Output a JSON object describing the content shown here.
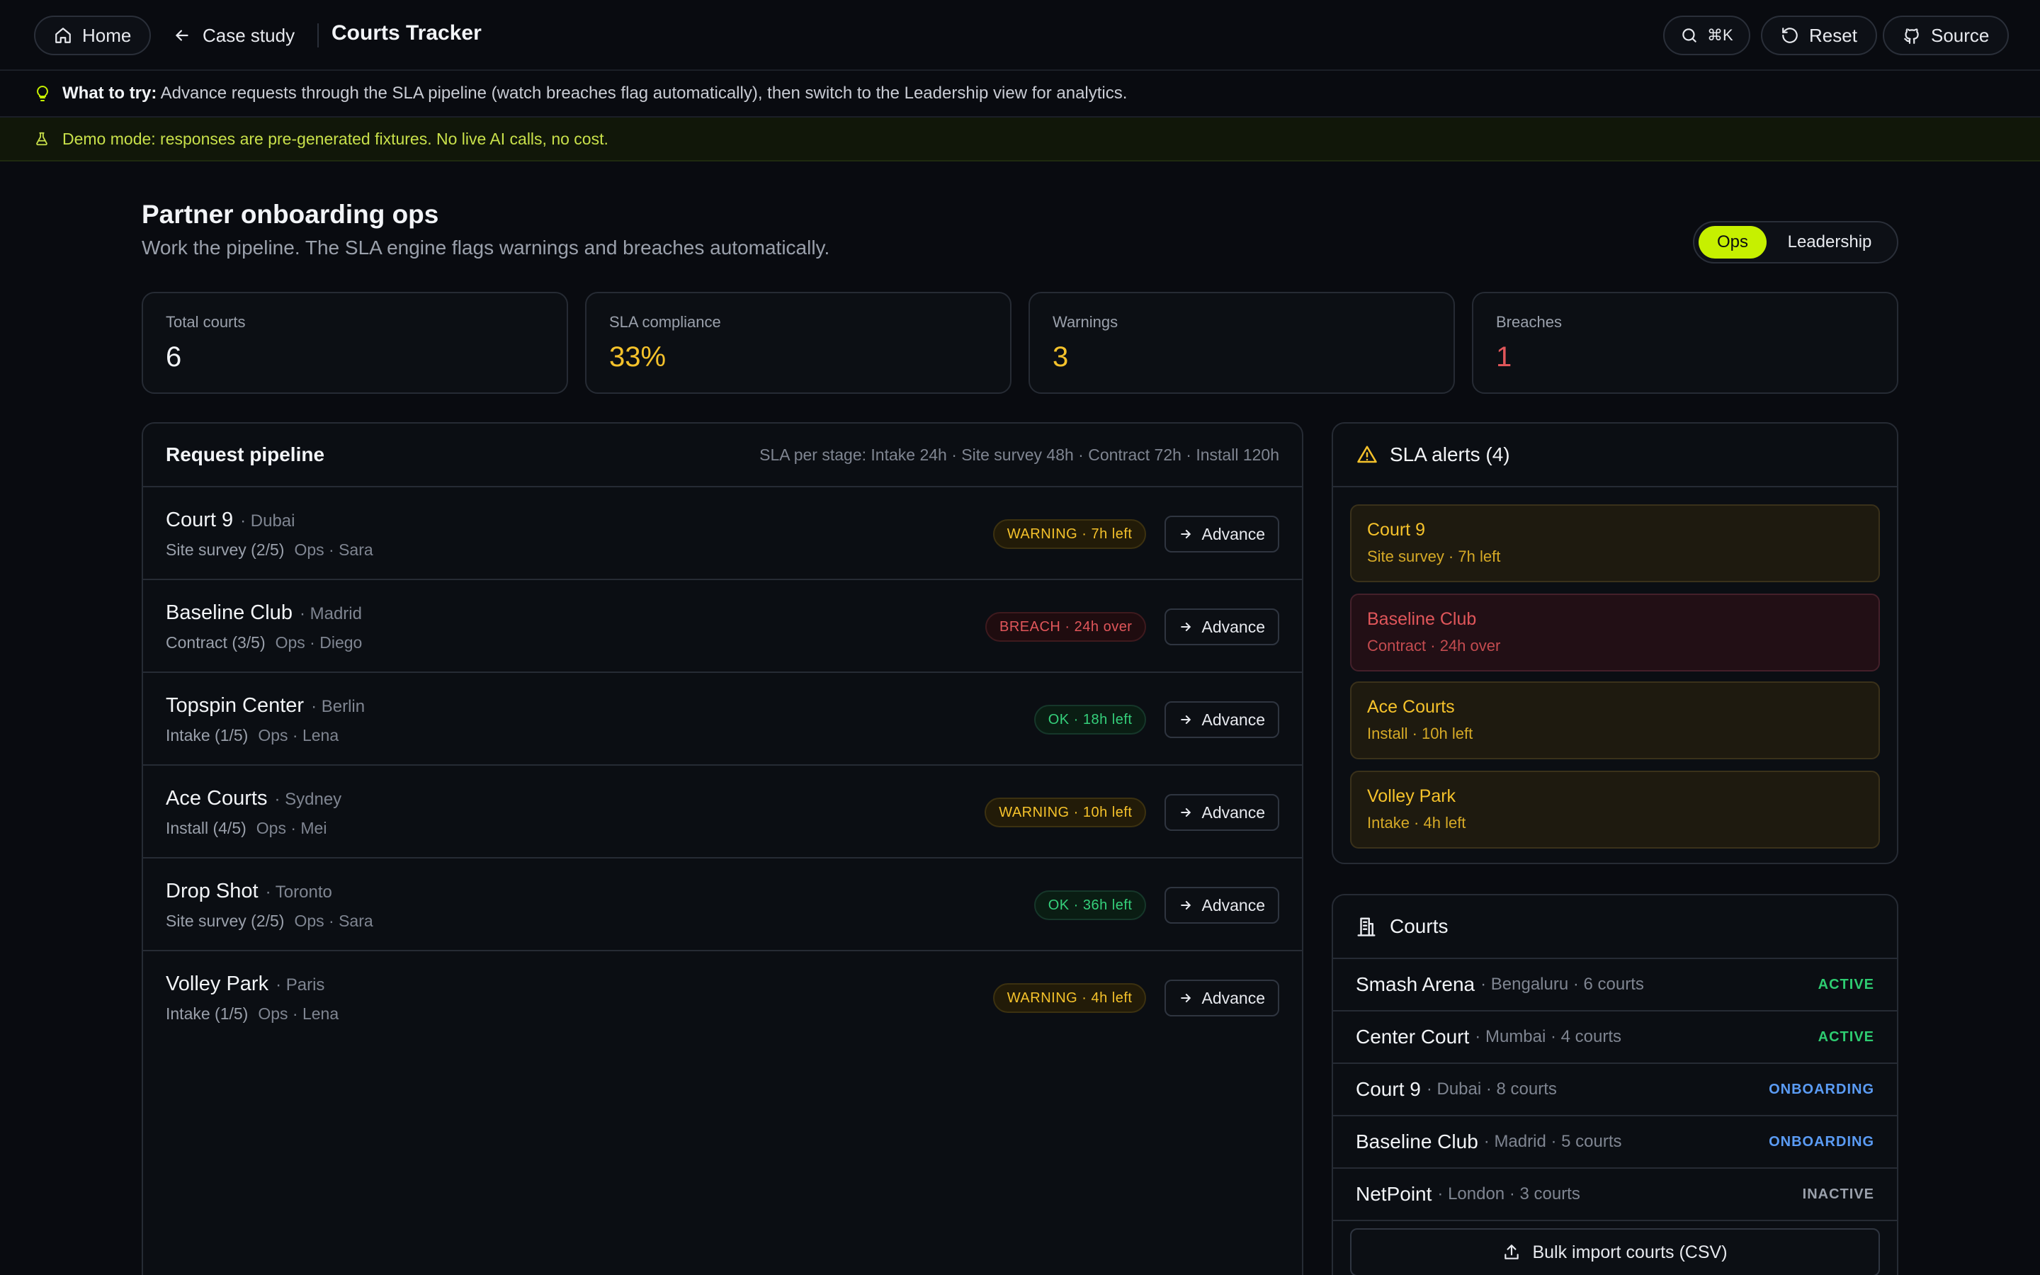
{
  "nav": {
    "home_label": "Home",
    "back_label": "Case study",
    "app_title": "Courts Tracker",
    "search_shortcut": "⌘K",
    "reset_label": "Reset",
    "source_label": "Source"
  },
  "tip": {
    "prefix": "What to try:",
    "text": "Advance requests through the SLA pipeline (watch breaches flag automatically), then switch to the Leadership view for analytics."
  },
  "demo_notice": "Demo mode: responses are pre-generated fixtures. No live AI calls, no cost.",
  "page": {
    "title": "Partner onboarding ops",
    "subtitle": "Work the pipeline. The SLA engine flags warnings and breaches automatically."
  },
  "view_toggle": {
    "options": [
      "Ops",
      "Leadership"
    ],
    "selected": "Ops"
  },
  "stats": [
    {
      "label": "Total courts",
      "value": "6",
      "color": "#f2f4f7"
    },
    {
      "label": "SLA compliance",
      "value": "33%",
      "color": "#f5c22b"
    },
    {
      "label": "Warnings",
      "value": "3",
      "color": "#f5c22b"
    },
    {
      "label": "Breaches",
      "value": "1",
      "color": "#e0565a"
    }
  ],
  "pipeline": {
    "title": "Request pipeline",
    "sla_note": "SLA per stage: Intake 24h · Site survey 48h · Contract 72h · Install 120h",
    "advance_label": "Advance",
    "rows": [
      {
        "name": "Court 9",
        "city": "· Dubai",
        "stage": "Site survey (2/5)",
        "owner": "Ops · Sara",
        "status": "WARNING · 7h left",
        "level": "warn"
      },
      {
        "name": "Baseline Club",
        "city": "· Madrid",
        "stage": "Contract (3/5)",
        "owner": "Ops · Diego",
        "status": "BREACH · 24h over",
        "level": "breach"
      },
      {
        "name": "Topspin Center",
        "city": "· Berlin",
        "stage": "Intake (1/5)",
        "owner": "Ops · Lena",
        "status": "OK · 18h left",
        "level": "ok"
      },
      {
        "name": "Ace Courts",
        "city": "· Sydney",
        "stage": "Install (4/5)",
        "owner": "Ops · Mei",
        "status": "WARNING · 10h left",
        "level": "warn"
      },
      {
        "name": "Drop Shot",
        "city": "· Toronto",
        "stage": "Site survey (2/5)",
        "owner": "Ops · Sara",
        "status": "OK · 36h left",
        "level": "ok"
      },
      {
        "name": "Volley Park",
        "city": "· Paris",
        "stage": "Intake (1/5)",
        "owner": "Ops · Lena",
        "status": "WARNING · 4h left",
        "level": "warn"
      }
    ]
  },
  "alerts": {
    "title": "SLA alerts (4)",
    "items": [
      {
        "name": "Court 9",
        "detail": "Site survey · 7h left",
        "level": "warn"
      },
      {
        "name": "Baseline Club",
        "detail": "Contract · 24h over",
        "level": "breach"
      },
      {
        "name": "Ace Courts",
        "detail": "Install · 10h left",
        "level": "warn"
      },
      {
        "name": "Volley Park",
        "detail": "Intake · 4h left",
        "level": "warn"
      }
    ]
  },
  "courts": {
    "title": "Courts",
    "items": [
      {
        "name": "Smash Arena",
        "detail": "· Bengaluru · 6 courts",
        "status": "ACTIVE"
      },
      {
        "name": "Center Court",
        "detail": "· Mumbai · 4 courts",
        "status": "ACTIVE"
      },
      {
        "name": "Court 9",
        "detail": "· Dubai · 8 courts",
        "status": "ONBOARDING"
      },
      {
        "name": "Baseline Club",
        "detail": "· Madrid · 5 courts",
        "status": "ONBOARDING"
      },
      {
        "name": "NetPoint",
        "detail": "· London · 3 courts",
        "status": "INACTIVE"
      }
    ],
    "bulk_import_label": "Bulk import courts (CSV)"
  },
  "icons": {
    "home": "home-icon",
    "back": "arrow-left-icon",
    "search": "search-icon",
    "reset": "rotate-ccw-icon",
    "source": "github-icon",
    "tip": "lightbulb-icon",
    "demo": "flask-icon",
    "alert": "warning-triangle-icon",
    "courts": "building-icon",
    "advance": "arrow-right-icon",
    "upload": "upload-icon"
  }
}
